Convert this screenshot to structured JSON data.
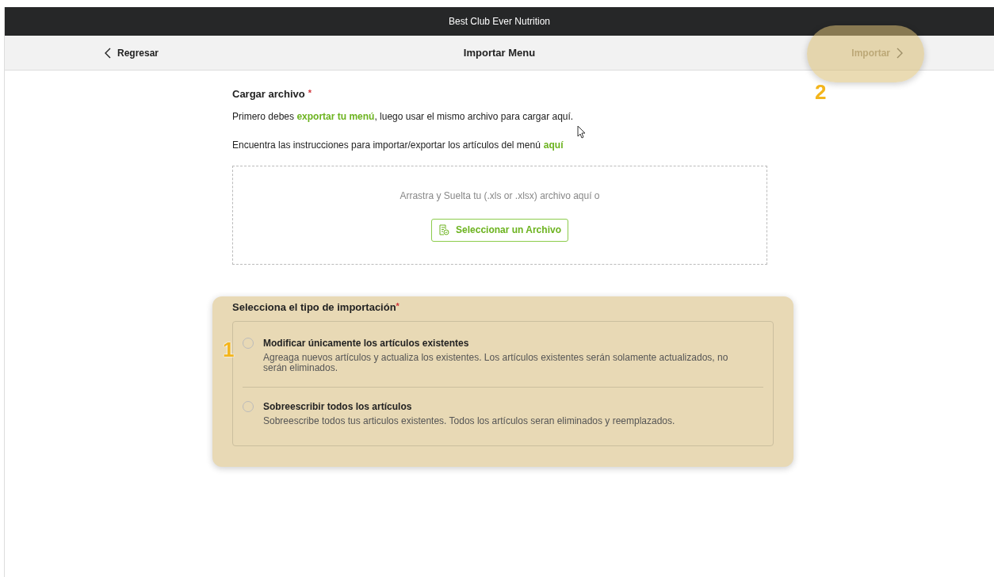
{
  "app_bar": {
    "title": "Best Club Ever Nutrition"
  },
  "nav_bar": {
    "back": "Regresar",
    "title": "Importar Menu",
    "action": {
      "label": "Importar",
      "disabled": true,
      "highlighted": true
    }
  },
  "upload": {
    "label": "Cargar archivo",
    "required_mark": "*",
    "intro": "Primero debes **exportar tu menú**, luego usar el mismo archivo para cargar aquí.",
    "instructions": "Encuentra las instrucciones para importar/exportar los artículos del menú",
    "instructions_link": "aquí",
    "dropzone_text": "Arrastra y Suelta tu (.xls or .xlsx) archivo aquí o",
    "select_button": "Seleccionar un Archivo"
  },
  "import_type": {
    "label": "Selecciona el tipo de importación",
    "required_mark": "*",
    "highlighted": true,
    "options": [
      {
        "title": "Modificar únicamente los artículos existentes",
        "description": "Agreaga nuevos artículos y actualiza los existentes. Los artículos existentes serán solamente actualizados, no serán eliminados.",
        "selected": false
      },
      {
        "title": "Sobreescribir todos los artículos",
        "description": "Sobreescribe todos tus articulos existentes. Todos los artículos seran eliminados y reemplazados.",
        "selected": false
      }
    ]
  },
  "callouts": [
    "1",
    "2"
  ]
}
